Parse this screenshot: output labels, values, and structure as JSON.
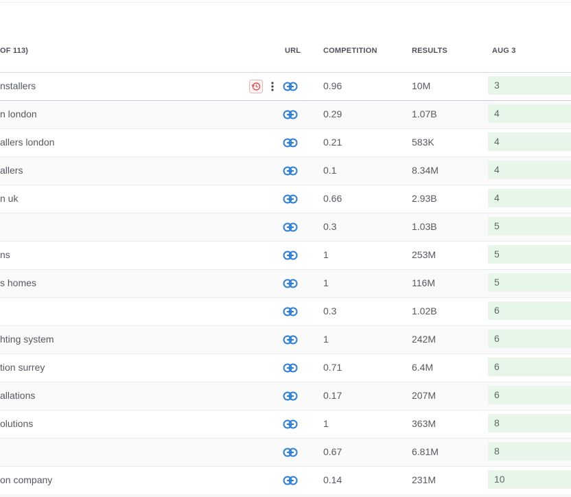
{
  "header": {
    "keyword_count_label": "OF 113)",
    "url_label": "URL",
    "competition_label": "COMPETITION",
    "results_label": "RESULTS",
    "date_label": "AUG 3"
  },
  "rows": [
    {
      "keyword": "nstallers",
      "competition": "0.96",
      "results": "10M",
      "rank": "3"
    },
    {
      "keyword": "n london",
      "competition": "0.29",
      "results": "1.07B",
      "rank": "4"
    },
    {
      "keyword": "allers london",
      "competition": "0.21",
      "results": "583K",
      "rank": "4"
    },
    {
      "keyword": "allers",
      "competition": "0.1",
      "results": "8.34M",
      "rank": "4"
    },
    {
      "keyword": "n uk",
      "competition": "0.66",
      "results": "2.93B",
      "rank": "4"
    },
    {
      "keyword": "",
      "competition": "0.3",
      "results": "1.03B",
      "rank": "5"
    },
    {
      "keyword": "ns",
      "competition": "1",
      "results": "253M",
      "rank": "5"
    },
    {
      "keyword": "s homes",
      "competition": "1",
      "results": "116M",
      "rank": "5"
    },
    {
      "keyword": "",
      "competition": "0.3",
      "results": "1.02B",
      "rank": "6"
    },
    {
      "keyword": "hting system",
      "competition": "1",
      "results": "242M",
      "rank": "6"
    },
    {
      "keyword": "tion surrey",
      "competition": "0.71",
      "results": "6.4M",
      "rank": "6"
    },
    {
      "keyword": "allations",
      "competition": "0.17",
      "results": "207M",
      "rank": "6"
    },
    {
      "keyword": "olutions",
      "competition": "1",
      "results": "363M",
      "rank": "8"
    },
    {
      "keyword": "",
      "competition": "0.67",
      "results": "6.81M",
      "rank": "8"
    },
    {
      "keyword": "on company",
      "competition": "0.14",
      "results": "231M",
      "rank": "10"
    }
  ],
  "colors": {
    "link_icon": "#2d7fd6",
    "rank_bg": "#e8f6ea",
    "history_icon": "#d9534f"
  },
  "icons": {
    "link": "link-icon",
    "history": "history-icon",
    "more": "more-vertical-icon"
  }
}
